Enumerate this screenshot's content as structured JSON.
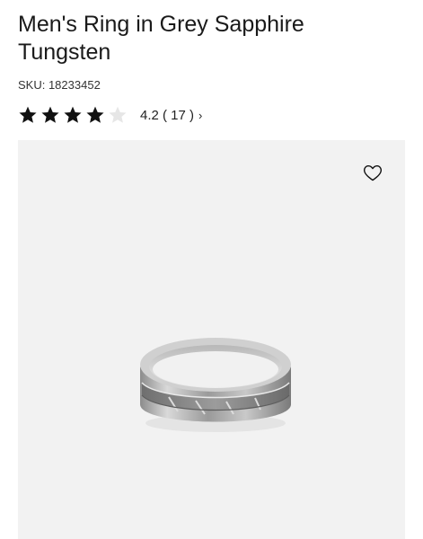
{
  "product": {
    "title": "Men's Ring in Grey Sapphire Tungsten",
    "sku_label": "SKU: 18233452"
  },
  "rating": {
    "value": 4.2,
    "display": "4.2 ( 17 )",
    "chevron": "›",
    "stars_filled": 4,
    "stars_total": 5
  },
  "icons": {
    "wishlist": "heart-outline-icon",
    "star": "star-icon"
  },
  "colors": {
    "star_filled": "#111111",
    "star_empty": "#e6e6e6",
    "image_background": "#f2f2f2"
  }
}
